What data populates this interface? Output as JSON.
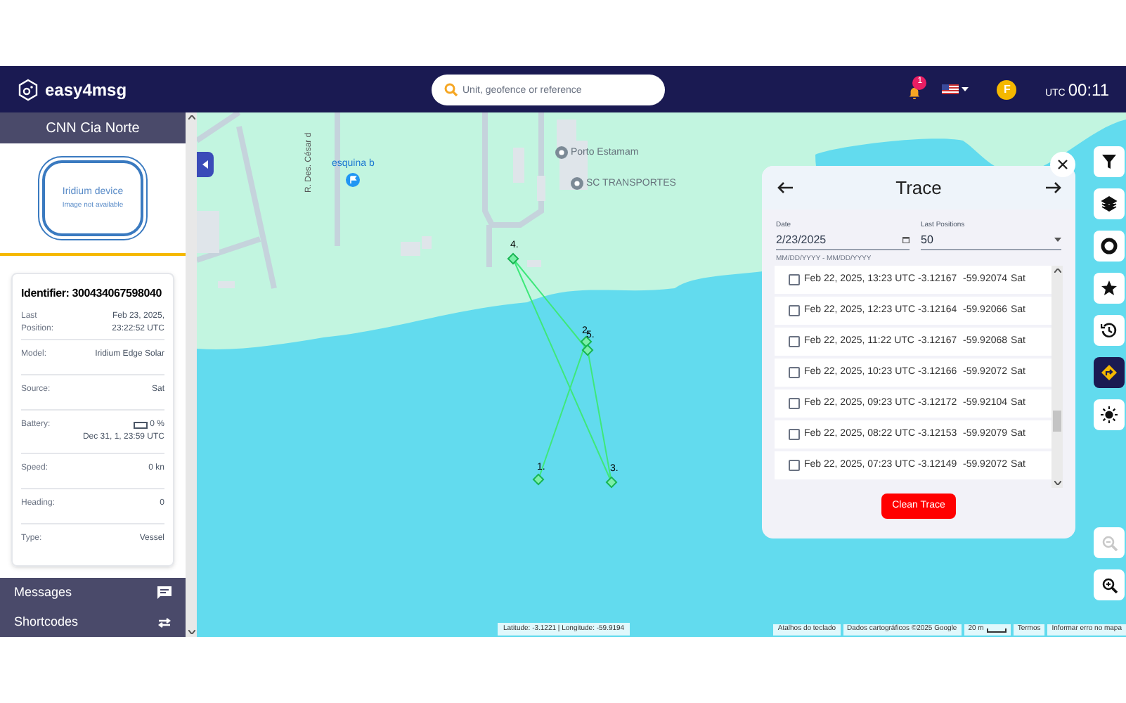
{
  "header": {
    "brand": "easy4msg",
    "search": {
      "placeholder": "Unit, geofence or reference"
    },
    "notifications": "1",
    "avatar": "F",
    "clock_label": "UTC",
    "clock": "00:11"
  },
  "sidebar": {
    "title": "CNN Cia Norte",
    "device_image": {
      "title": "Iridium device",
      "subtitle": "Image not available"
    },
    "identifier": "Identifier: 300434067598040",
    "details": [
      {
        "kind": "text",
        "label": "Last Position:",
        "value": "Feb 23, 2025, 23:22:52 UTC"
      },
      {
        "kind": "text",
        "label": "Model:",
        "value": "Iridium Edge Solar"
      },
      {
        "kind": "text",
        "label": "Source:",
        "value": "Sat"
      },
      {
        "kind": "battery",
        "label": "Battery:",
        "value": "0 %",
        "level": 0,
        "date": "Dec 31, 1, 23:59 UTC"
      },
      {
        "kind": "text",
        "label": "Speed:",
        "value": "0 kn"
      },
      {
        "kind": "text",
        "label": "Heading:",
        "value": "0"
      },
      {
        "kind": "text",
        "label": "Type:",
        "value": "Vessel"
      }
    ],
    "menu": [
      {
        "label": "Messages"
      },
      {
        "label": "Shortcodes"
      }
    ]
  },
  "map": {
    "labels": [
      {
        "kind": "street",
        "text": "R. Des. César d"
      },
      {
        "kind": "poi-blue",
        "text": "esquina b"
      },
      {
        "kind": "poi",
        "text": "Porto Estamam"
      },
      {
        "kind": "poi",
        "text": "SC TRANSPORTES"
      }
    ],
    "points": [
      {
        "label": "1."
      },
      {
        "label": "2."
      },
      {
        "label": "3."
      },
      {
        "label": "4."
      },
      {
        "label": "5."
      }
    ],
    "coordinates": "Latitude: -3.1221 | Longitude: -59.9194",
    "attribution": [
      "Atalhos do teclado",
      "Dados cartográficos ©2025 Google",
      "20 m",
      "Termos",
      "Informar erro no mapa"
    ]
  },
  "trace": {
    "title": "Trace",
    "date": {
      "label": "Date",
      "value": "2/23/2025",
      "hint": "MM/DD/YYYY - MM/DD/YYYY"
    },
    "last_positions": {
      "label": "Last Positions",
      "value": "50"
    },
    "rows": [
      {
        "time": "Feb 22, 2025, 13:23 UTC",
        "lat": "-3.12167",
        "lon": "-59.92074",
        "source": "Sat",
        "checked": false
      },
      {
        "time": "Feb 22, 2025, 12:23 UTC",
        "lat": "-3.12164",
        "lon": "-59.92066",
        "source": "Sat",
        "checked": false
      },
      {
        "time": "Feb 22, 2025, 11:22 UTC",
        "lat": "-3.12167",
        "lon": "-59.92068",
        "source": "Sat",
        "checked": false
      },
      {
        "time": "Feb 22, 2025, 10:23 UTC",
        "lat": "-3.12166",
        "lon": "-59.92072",
        "source": "Sat",
        "checked": false
      },
      {
        "time": "Feb 22, 2025, 09:23 UTC",
        "lat": "-3.12172",
        "lon": "-59.92104",
        "source": "Sat",
        "checked": false
      },
      {
        "time": "Feb 22, 2025, 08:22 UTC",
        "lat": "-3.12153",
        "lon": "-59.92079",
        "source": "Sat",
        "checked": false
      },
      {
        "time": "Feb 22, 2025, 07:23 UTC",
        "lat": "-3.12149",
        "lon": "-59.92072",
        "source": "Sat",
        "checked": false
      }
    ],
    "clean_button": "Clean Trace"
  },
  "toolbar": [
    {
      "selected": false
    },
    {
      "selected": false
    },
    {
      "selected": false
    },
    {
      "selected": false
    },
    {
      "selected": false
    },
    {
      "selected": true
    },
    {
      "selected": false
    }
  ],
  "zoom": [
    {
      "disabled": true
    },
    {
      "disabled": false
    }
  ]
}
